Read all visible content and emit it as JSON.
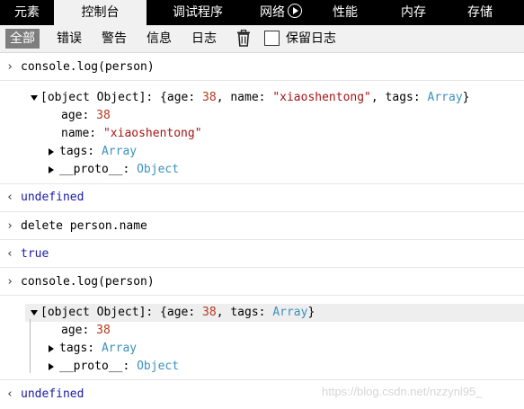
{
  "tabs": [
    {
      "label": "元素"
    },
    {
      "label": "控制台"
    },
    {
      "label": "调试程序"
    },
    {
      "label": "网络"
    },
    {
      "label": "性能"
    },
    {
      "label": "内存"
    },
    {
      "label": "存储"
    }
  ],
  "toolbar": {
    "filters": [
      {
        "label": "全部"
      },
      {
        "label": "错误"
      },
      {
        "label": "警告"
      },
      {
        "label": "信息"
      },
      {
        "label": "日志"
      }
    ],
    "clear_icon": "trash-icon",
    "preserve_log_label": "保留日志",
    "preserve_log_checked": false
  },
  "console": {
    "entry1": {
      "input": "console.log(person)",
      "object_prefix": "[object Object]: {",
      "summary_age_key": "age: ",
      "summary_age_val": "38",
      "summary_sep1": ", ",
      "summary_name_key": "name: ",
      "summary_name_val": "\"xiaoshentong\"",
      "summary_sep2": ", ",
      "summary_tags_key": "tags: ",
      "summary_tags_val": "Array",
      "summary_close": "}",
      "prop_age_key": "age: ",
      "prop_age_val": "38",
      "prop_name_key": "name: ",
      "prop_name_val": "\"xiaoshentong\"",
      "prop_tags_key": "tags: ",
      "prop_tags_val": "Array",
      "prop_proto_key": "__proto__: ",
      "prop_proto_val": "Object"
    },
    "result1": "undefined",
    "entry2": {
      "input": "delete person.name"
    },
    "result2": "true",
    "entry3": {
      "input": "console.log(person)",
      "object_prefix": "[object Object]: {",
      "summary_age_key": "age: ",
      "summary_age_val": "38",
      "summary_sep1": ", ",
      "summary_tags_key": "tags: ",
      "summary_tags_val": "Array",
      "summary_close": "}",
      "prop_age_key": "age: ",
      "prop_age_val": "38",
      "prop_tags_key": "tags: ",
      "prop_tags_val": "Array",
      "prop_proto_key": "__proto__: ",
      "prop_proto_val": "Object"
    },
    "result3": "undefined"
  },
  "watermark": "https://blog.csdn.net/nzzynl95_",
  "colors": {
    "tabbar_bg": "#000000",
    "active_tab_bg": "#f1f1f1",
    "filter_active_bg": "#7e7e7e",
    "number": "#b5381b",
    "string": "#a31515",
    "type": "#3b91bf",
    "result": "#1a1aa6"
  }
}
